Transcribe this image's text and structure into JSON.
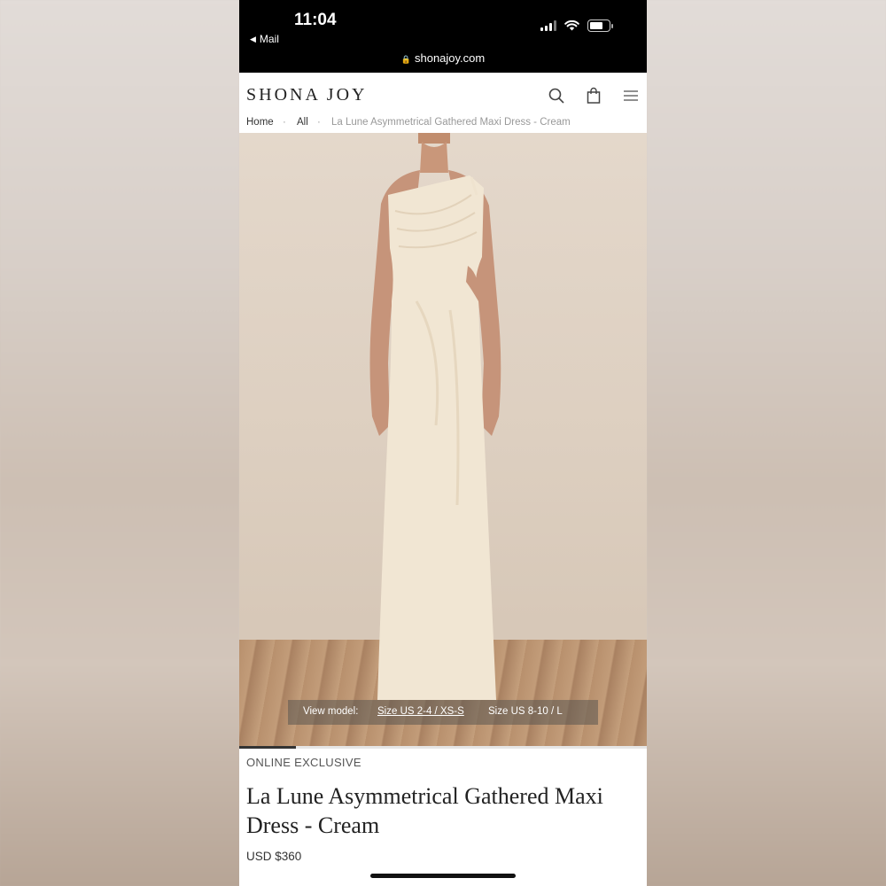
{
  "status_bar": {
    "time": "11:04",
    "back_app": "Mail",
    "url": "shonajoy.com"
  },
  "header": {
    "logo": "SHONA JOY",
    "icons": [
      "search-icon",
      "shopping-bag-icon",
      "menu-icon"
    ]
  },
  "breadcrumb": {
    "items": [
      "Home",
      "All",
      "La Lune Asymmetrical Gathered Maxi Dress - Cream"
    ],
    "separator": "·"
  },
  "gallery": {
    "view_model_label": "View model:",
    "size_options": [
      "Size US 2-4 / XS-S",
      "Size US 8-10 / L"
    ],
    "selected_size": "Size US 2-4 / XS-S",
    "progress": 0.14
  },
  "product": {
    "badge": "ONLINE EXCLUSIVE",
    "title": "La Lune Asymmetrical Gathered Maxi Dress - Cream",
    "price": "USD $360"
  },
  "colors": {
    "dress": "#f1e6d3",
    "skin": "#c9987a",
    "wall": "#e0d3c5",
    "floor": "#b8906d"
  }
}
